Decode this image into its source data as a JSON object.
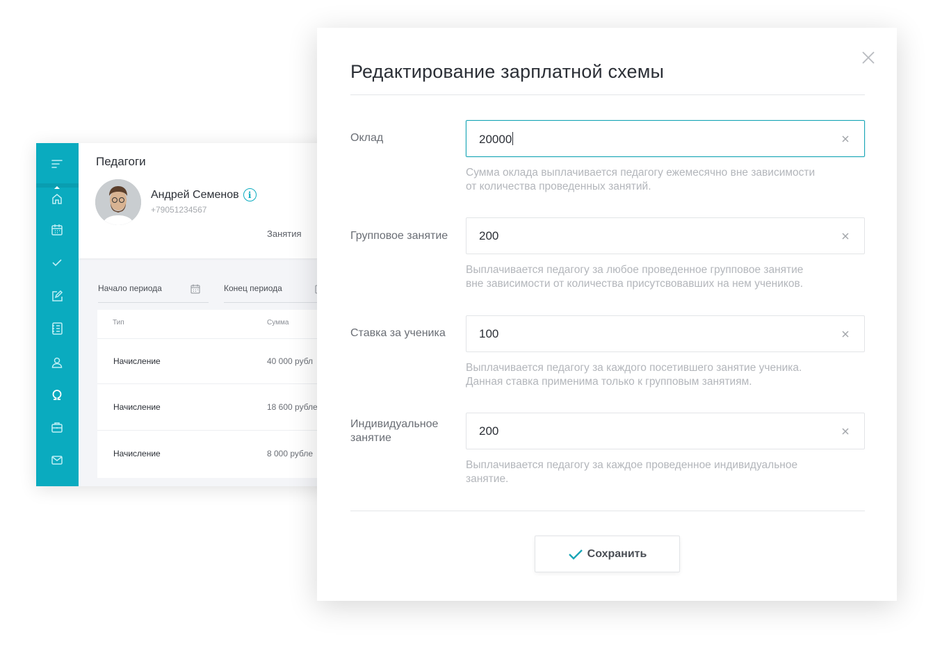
{
  "app": {
    "page_title": "Педагоги",
    "teacher": {
      "name": "Андрей Семенов",
      "phone": "+79051234567"
    },
    "tab_lessons": "Занятия",
    "filters": {
      "start_label": "Начало периода",
      "end_label": "Конец периода"
    },
    "table": {
      "headers": [
        "Тип",
        "Сумма"
      ],
      "rows": [
        {
          "type": "Начисление",
          "sum": "40 000 рубл"
        },
        {
          "type": "Начисление",
          "sum": "18 600 рубле"
        },
        {
          "type": "Начисление",
          "sum": "8 000 рубле"
        }
      ]
    },
    "sidebar_icons": [
      "menu-icon",
      "home-icon",
      "calendar-icon",
      "check-icon",
      "edit-icon",
      "notebook-icon",
      "user-icon",
      "omega-icon",
      "briefcase-icon",
      "mail-icon"
    ],
    "accent_color": "#0aabbf"
  },
  "modal": {
    "title": "Редактирование зарплатной схемы",
    "fields": [
      {
        "label": "Оклад",
        "value": "20000",
        "help": [
          "Сумма оклада выплачивается педагогу ежемесячно вне зависимости",
          "от количества проведенных занятий."
        ]
      },
      {
        "label": "Групповое занятие",
        "value": "200",
        "help": [
          "Выплачивается педагогу за любое проведенное групповое занятие",
          "вне зависимости от количества присутсвовавших на нем учеников."
        ]
      },
      {
        "label": "Ставка за ученика",
        "value": "100",
        "help": [
          "Выплачивается педагогу за каждого посетившего занятие ученика.",
          "Данная ставка применима только к групповым занятиям."
        ]
      },
      {
        "label": "Индивидуальное занятие",
        "value": "200",
        "help": [
          "Выплачивается педагогу за каждое проведенное индивидуальное",
          "занятие."
        ]
      }
    ],
    "save_label": "Сохранить"
  }
}
